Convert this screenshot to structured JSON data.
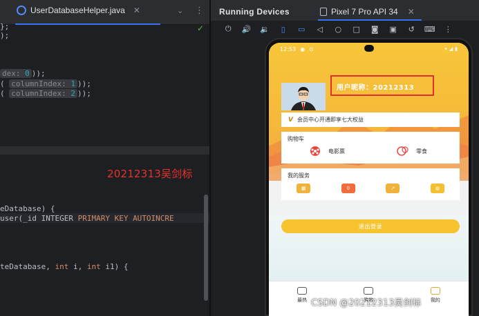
{
  "editor": {
    "tab_label": "UserDatabaseHelper.java",
    "tab_close": "✕",
    "tab_dropdown": "⌄",
    "tab_more": "⋮",
    "inspection": "✓",
    "lines": {
      "l1": "};",
      "l2": ");",
      "l3_hint": "dex:",
      "l3_num": "0",
      "l3_tail": "));",
      "l4_pre": "(",
      "l4_hint": "columnIndex:",
      "l4_num": "1",
      "l4_tail": "));",
      "l5_pre": "(",
      "l5_hint": "columnIndex:",
      "l5_num": "2",
      "l5_tail": "));",
      "l6": "eDatabase) {",
      "l7_a": "user(_id INTEGER ",
      "l7_b": "PRIMARY KEY AUTOINCRE",
      "l8_a": "teDatabase, ",
      "l8_kw1": "int",
      "l8_b": " i, ",
      "l8_kw2": "int",
      "l8_c": " i1) {"
    },
    "watermark": "20212313吴剑标"
  },
  "running_devices": {
    "title": "Running Devices",
    "device_tab": "Pixel 7 Pro API 34",
    "close": "✕",
    "toolbar_icons": [
      "power-icon",
      "volume-up-icon",
      "volume-down-icon",
      "rotate-left-icon",
      "rotate-right-icon",
      "back-icon",
      "home-icon",
      "overview-icon",
      "screenshot-icon",
      "screen-record-icon",
      "snapshot-icon",
      "keyboard-icon",
      "more-icon"
    ]
  },
  "phone": {
    "time": "12:53",
    "nickname": "用户昵称：20212313",
    "vip_badge": "V",
    "vip_text": "会员中心开通即享七大权益",
    "cart_title": "购物车",
    "cart_items": [
      {
        "label": "电影票",
        "icon": "movie-ticket-icon"
      },
      {
        "label": "零食",
        "icon": "snack-icon"
      }
    ],
    "services_title": "我的服务",
    "services": [
      {
        "icon": "calendar-icon",
        "color": "#f0b23a"
      },
      {
        "icon": "coupon-icon",
        "color": "#f26b3a"
      },
      {
        "icon": "share-icon",
        "color": "#f0b23a"
      },
      {
        "icon": "wallet-icon",
        "color": "#f5c030"
      }
    ],
    "logout": "退出登录",
    "nav": [
      {
        "label": "最热",
        "icon": "hot-icon"
      },
      {
        "label": "购物",
        "icon": "shopping-icon"
      },
      {
        "label": "我的",
        "icon": "profile-icon"
      }
    ],
    "accent": "#f7c32f"
  },
  "overlay_watermark": "CSDN @20212313吴剑标"
}
